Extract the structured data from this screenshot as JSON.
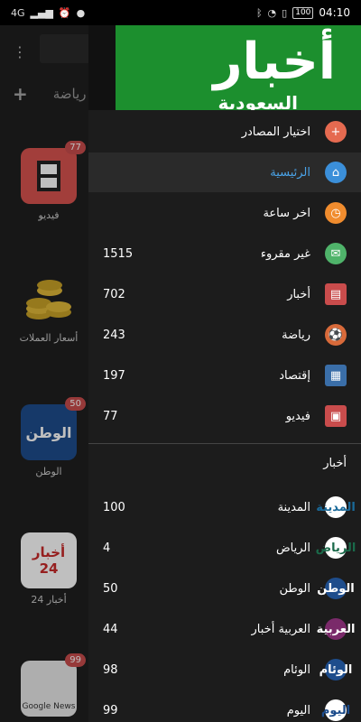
{
  "statusbar": {
    "network": "4G",
    "time": "04:10",
    "battery": "100"
  },
  "background": {
    "tab": "رياضة",
    "items": [
      {
        "label": "فيديو",
        "badge": "77"
      },
      {
        "label": "أسعار العملات",
        "badge": ""
      },
      {
        "label": "الوطن",
        "badge": "50",
        "logo": "الوطن"
      },
      {
        "label": "أخبار 24",
        "badge": "",
        "logo": "أخبار 24"
      },
      {
        "label": "Google News",
        "badge": "99"
      }
    ]
  },
  "drawer": {
    "header": {
      "title": "أخبار",
      "subtitle": "السعودية"
    },
    "menu": [
      {
        "label": "اختيار المصادر",
        "count": "",
        "icon": "plus-icon",
        "color": "#e56a50"
      },
      {
        "label": "الرئيسية",
        "count": "",
        "icon": "home-icon",
        "color": "#3b8fd9",
        "active": true
      },
      {
        "label": "اخر ساعة",
        "count": "",
        "icon": "clock-icon",
        "color": "#f08c2e"
      },
      {
        "label": "غير مقروء",
        "count": "1515",
        "icon": "mail-icon",
        "color": "#4fb36a"
      },
      {
        "label": "أخبار",
        "count": "702",
        "icon": "newspaper-icon",
        "color": "#c94c4c"
      },
      {
        "label": "رياضة",
        "count": "243",
        "icon": "sports-icon",
        "color": "#d86a3a"
      },
      {
        "label": "إقتصاد",
        "count": "197",
        "icon": "economy-icon",
        "color": "#3a6ea8"
      },
      {
        "label": "فيديو",
        "count": "77",
        "icon": "film-icon",
        "color": "#c94c4c"
      }
    ],
    "section_title": "أخبار",
    "sources": [
      {
        "label": "المدينة",
        "count": "100",
        "logo": "المدينة"
      },
      {
        "label": "الرياض",
        "count": "4",
        "logo": "الرياض"
      },
      {
        "label": "الوطن",
        "count": "50",
        "logo": "الوطن"
      },
      {
        "label": "العربية أخبار",
        "count": "44",
        "logo": "العربية"
      },
      {
        "label": "الوئام",
        "count": "98",
        "logo": "الوئام"
      },
      {
        "label": "اليوم",
        "count": "99",
        "logo": "اليوم"
      }
    ]
  }
}
